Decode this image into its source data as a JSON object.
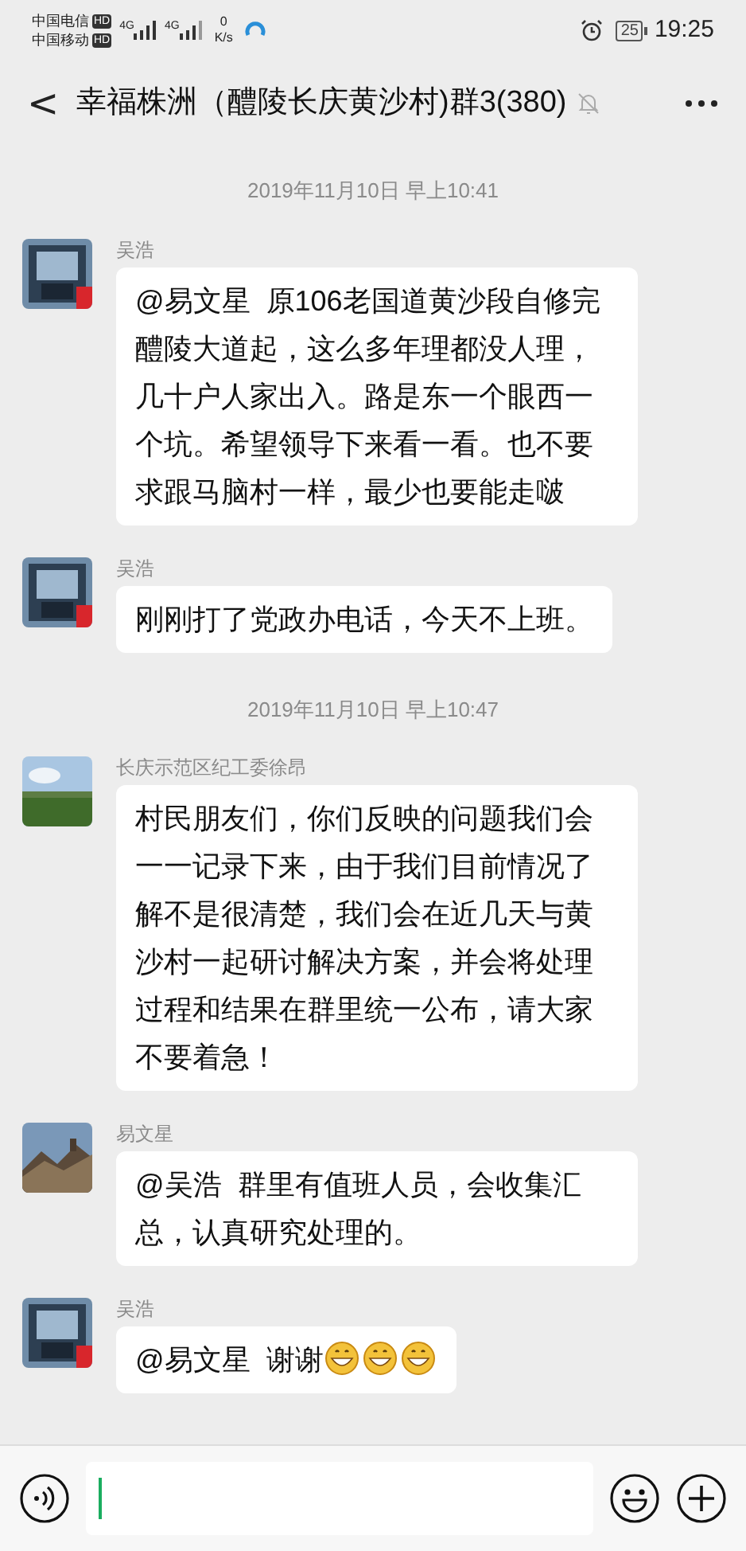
{
  "status_bar": {
    "carrier_1": "中国电信",
    "carrier_2": "中国移动",
    "hd_1": "HD",
    "hd_2": "HD",
    "net_1": "4G",
    "net_2": "4G",
    "speed_value": "0",
    "speed_unit": "K/s",
    "battery": "25",
    "time": "19:25"
  },
  "header": {
    "back": "<",
    "title": "幸福株洲（醴陵长庆黄沙村)群3(380)",
    "muted": true
  },
  "messages": [
    {
      "kind": "timestamp",
      "text": "2019年11月10日 早上10:41"
    },
    {
      "kind": "message",
      "sender": "吴浩",
      "text": "@易文星  原106老国道黄沙段自修完醴陵大道起，这么多年理都没人理，几十户人家出入。路是东一个眼西一个坑。希望领导下来看一看。也不要求跟马脑村一样，最少也要能走啵"
    },
    {
      "kind": "message",
      "sender": "吴浩",
      "text": "刚刚打了党政办电话，今天不上班。"
    },
    {
      "kind": "timestamp",
      "text": "2019年11月10日 早上10:47"
    },
    {
      "kind": "message",
      "sender": "长庆示范区纪工委徐昂",
      "text": "村民朋友们，你们反映的问题我们会一一记录下来，由于我们目前情况了解不是很清楚，我们会在近几天与黄沙村一起研讨解决方案，并会将处理过程和结果在群里统一公布，请大家不要着急！"
    },
    {
      "kind": "message",
      "sender": "易文星",
      "text": "@吴浩  群里有值班人员，会收集汇总，认真研究处理的。"
    },
    {
      "kind": "message",
      "sender": "吴浩",
      "text": "@易文星  谢谢",
      "emojis": [
        {
          "kind": "grin"
        },
        {
          "kind": "grin"
        },
        {
          "kind": "grin"
        }
      ]
    }
  ]
}
